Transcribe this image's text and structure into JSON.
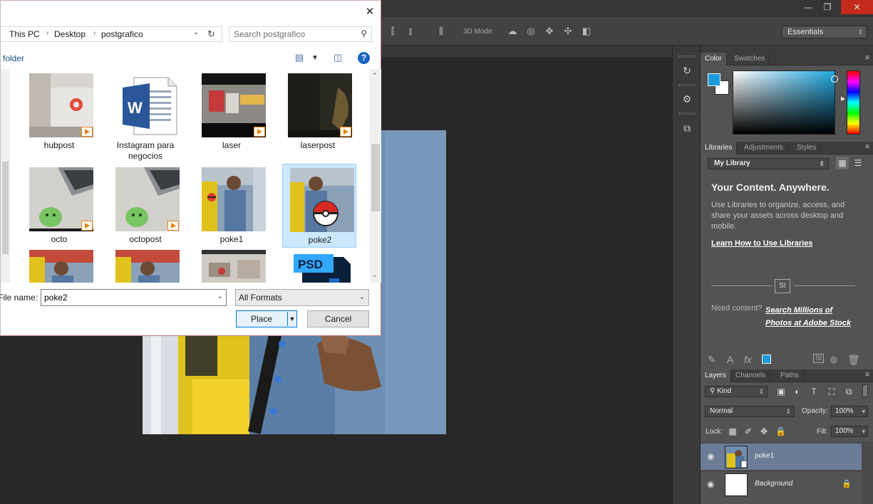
{
  "photoshop": {
    "window_controls": {
      "minimize": "—",
      "restore": "❐",
      "close": "✕"
    },
    "options_bar": {
      "mode_label": "3D Mode:"
    },
    "workspace": {
      "selected": "Essentials"
    },
    "color_panel": {
      "tabs": [
        "Color",
        "Swatches"
      ],
      "foreground_color": "#1e9bdb",
      "background_color": "#ffffff"
    },
    "libraries_panel": {
      "tabs": [
        "Libraries",
        "Adjustments",
        "Styles"
      ],
      "library_select": "My Library",
      "headline": "Your Content. Anywhere.",
      "description": "Use Libraries to organize, access, and share your assets across desktop and mobile.",
      "learn_link": "Learn How to Use Libraries",
      "stock_logo": "St",
      "need_content": "Need content?",
      "stock_link": "Search Millions of Photos at Adobe Stock"
    },
    "layers_panel": {
      "tabs": [
        "Layers",
        "Channels",
        "Paths"
      ],
      "filter_kind": "Kind",
      "blend_mode": "Normal",
      "opacity_label": "Opacity:",
      "opacity_value": "100%",
      "lock_label": "Lock:",
      "fill_label": "Fill:",
      "fill_value": "100%",
      "layers": [
        {
          "name": "poke1",
          "selected": true
        },
        {
          "name": "Background",
          "selected": false
        }
      ]
    }
  },
  "dialog": {
    "breadcrumb": [
      "This PC",
      "Desktop",
      "postgrafico"
    ],
    "search_placeholder": "Search postgrafico",
    "new_folder_label": "folder",
    "help_label": "?",
    "files": [
      {
        "name": "hubpost",
        "kind": "video"
      },
      {
        "name": "Instagram para negocios",
        "kind": "word"
      },
      {
        "name": "laser",
        "kind": "video"
      },
      {
        "name": "laserpost",
        "kind": "video"
      },
      {
        "name": "octo",
        "kind": "video"
      },
      {
        "name": "octopost",
        "kind": "video"
      },
      {
        "name": "poke1",
        "kind": "image"
      },
      {
        "name": "poke2",
        "kind": "image",
        "selected": true
      }
    ],
    "file_name_label": "File name:",
    "file_name_value": "poke2",
    "format_select": "All Formats",
    "place_button": "Place",
    "cancel_button": "Cancel",
    "psd_badge": "PSD"
  }
}
